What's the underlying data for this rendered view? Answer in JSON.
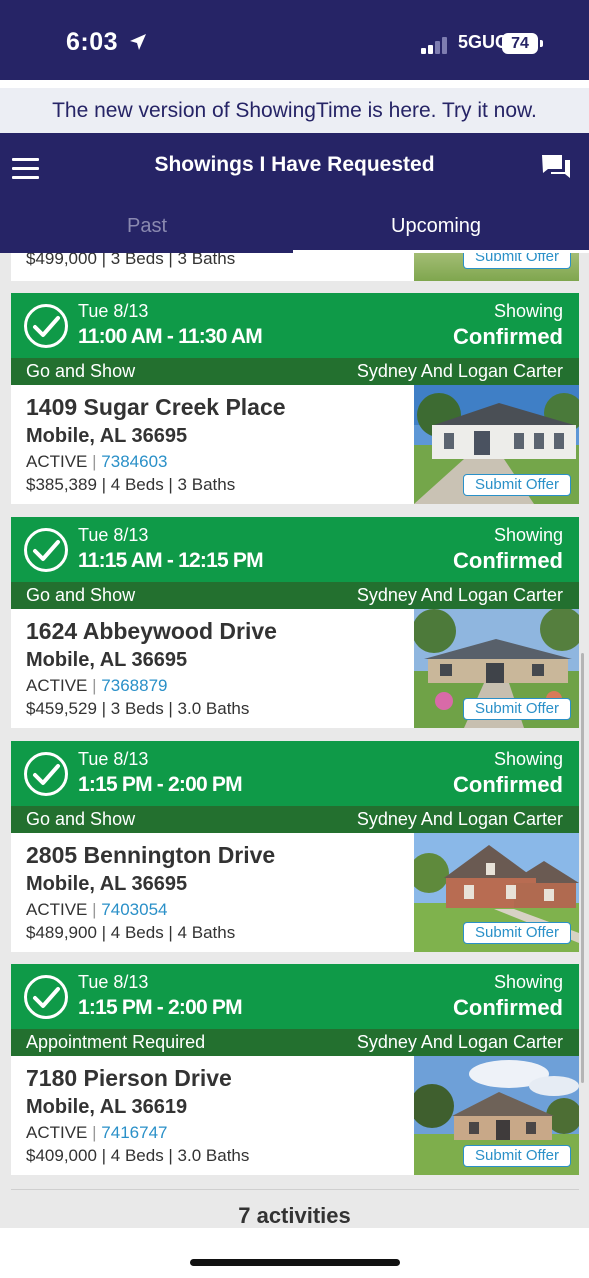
{
  "status_bar": {
    "time": "6:03",
    "network": "5GUC",
    "battery": "74"
  },
  "banner": {
    "text": "The new version of ShowingTime is here. Try it now."
  },
  "header": {
    "title": "Showings I Have Requested"
  },
  "tabs": [
    {
      "label": "Past"
    },
    {
      "label": "Upcoming"
    }
  ],
  "partial_card": {
    "details": "$499,000 | 3 Beds | 3 Baths",
    "offer_label": "Submit Offer"
  },
  "cards": [
    {
      "date": "Tue 8/13",
      "time": "11:00 AM - 11:30 AM",
      "status_line1": "Showing",
      "status_line2": "Confirmed",
      "show_type": "Go and Show",
      "agent": "Sydney And Logan Carter",
      "address": "1409 Sugar Creek Place",
      "city": "Mobile, AL 36695",
      "status": "ACTIVE",
      "mls": "7384603",
      "details": "$385,389 | 4 Beds | 3 Baths",
      "offer_label": "Submit Offer"
    },
    {
      "date": "Tue 8/13",
      "time": "11:15 AM - 12:15 PM",
      "status_line1": "Showing",
      "status_line2": "Confirmed",
      "show_type": "Go and Show",
      "agent": "Sydney And Logan Carter",
      "address": "1624 Abbeywood Drive",
      "city": "Mobile, AL 36695",
      "status": "ACTIVE",
      "mls": "7368879",
      "details": "$459,529 | 3 Beds | 3.0 Baths",
      "offer_label": "Submit Offer"
    },
    {
      "date": "Tue 8/13",
      "time": "1:15 PM - 2:00 PM",
      "status_line1": "Showing",
      "status_line2": "Confirmed",
      "show_type": "Go and Show",
      "agent": "Sydney And Logan Carter",
      "address": "2805 Bennington Drive",
      "city": "Mobile, AL 36695",
      "status": "ACTIVE",
      "mls": "7403054",
      "details": "$489,900 | 4 Beds | 4 Baths",
      "offer_label": "Submit Offer"
    },
    {
      "date": "Tue 8/13",
      "time": "1:15 PM - 2:00 PM",
      "status_line1": "Showing",
      "status_line2": "Confirmed",
      "show_type": "Appointment Required",
      "agent": "Sydney And Logan Carter",
      "address": "7180 Pierson Drive",
      "city": "Mobile, AL 36619",
      "status": "ACTIVE",
      "mls": "7416747",
      "details": "$409,000 | 4 Beds | 3.0 Baths",
      "offer_label": "Submit Offer"
    }
  ],
  "footer": {
    "activities": "7 activities"
  },
  "colors": {
    "header": "#262466",
    "confirmed_green": "#0f9a48",
    "sub_green": "#23702f",
    "link_blue": "#2a90c8"
  }
}
